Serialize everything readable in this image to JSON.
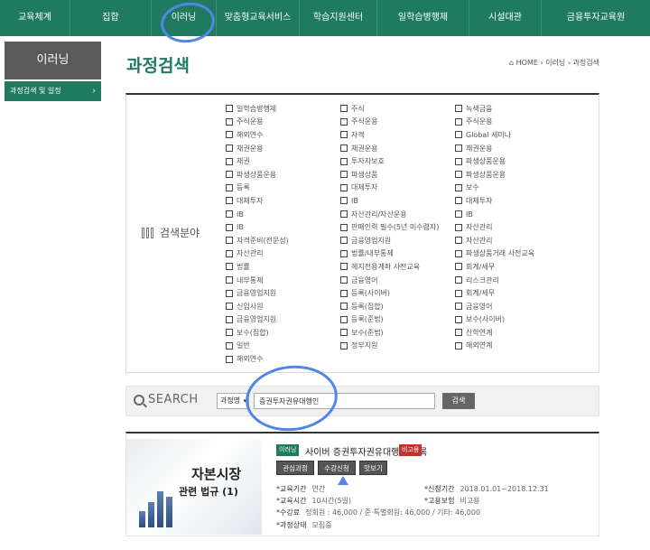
{
  "topnav": {
    "items": [
      "교육체계",
      "집합",
      "이러닝",
      "맞춤형교육서비스",
      "학습지원센터",
      "일학습병행제",
      "시설대관",
      "금융투자교육원"
    ]
  },
  "sidebar": {
    "title": "이러닝",
    "items": [
      {
        "label": "과정검색 및 일정",
        "arrow": "›"
      }
    ]
  },
  "page": {
    "title": "과정검색",
    "breadcrumb": "⌂ HOME › 이러닝 › 과정검색"
  },
  "filter": {
    "label": "검색분야",
    "columns": [
      [
        "일학습병행제",
        "주식운용",
        "해외연수",
        "채권운용",
        "채권",
        "파생상품운용",
        "등록",
        "대체투자",
        "IB",
        "IB",
        "자격준비(전문성)",
        "자산관리",
        "법률",
        "내부통제",
        "금융영업지원",
        "신입사원",
        "금융영업지원",
        "보수(집합)",
        "일반",
        "해외연수"
      ],
      [
        "주식",
        "주식운용",
        "자격",
        "채권운용",
        "투자자보호",
        "파생상품",
        "대체투자",
        "IB",
        "자산관리/자산운용",
        "판매인력 필수(5년 미수령자)",
        "금융영업지원",
        "법률/내부통제",
        "헤지전용계좌 사전교육",
        "금융영어",
        "등록(사이버)",
        "등록(집합)",
        "등록(준법)",
        "보수(준법)",
        "정부지원"
      ],
      [
        "녹색금융",
        "주식운용",
        "Global 세미나",
        "채권운용",
        "파생상품운용",
        "파생상품운용",
        "보수",
        "대체투자",
        "IB",
        "자산관리",
        "자산관리",
        "파생상품거래 사전교육",
        "회계/세무",
        "리스크관리",
        "회계/세무",
        "금융영어",
        "보수(사이버)",
        "산학연계",
        "해외연계"
      ]
    ]
  },
  "search": {
    "label": "SEARCH",
    "select_value": "과정명",
    "caret": "▾",
    "input_value": "증권투자권유대행인",
    "button_label": "검색"
  },
  "result": {
    "thumb_line1": "자본시장",
    "thumb_line2": "관련 법규 (1)",
    "category": "이러닝",
    "title": "사이버 증권투자권유대행인 등록",
    "type_badge": "비고용",
    "buttons": [
      "관심과정",
      "수강신청",
      "맛보기"
    ],
    "fields": [
      {
        "key": "*교육기간",
        "value": "연간"
      },
      {
        "key": "*교육시간",
        "value": "10시간(5일)"
      },
      {
        "key": "*수강료",
        "value": "정회원 : 46,000 / 준·특별회원: 46,000 / 기타: 46,000"
      },
      {
        "key": "*과정상태",
        "value": "모집중"
      }
    ],
    "right_fields": [
      {
        "key": "*신청기간",
        "value": "2018.01.01~2018.12.31"
      },
      {
        "key": "*고용보험",
        "value": "비고용"
      }
    ]
  },
  "colors": {
    "brand": "#1f7a60",
    "annotation": "#4f86e8",
    "badge_red": "#c0342e"
  }
}
